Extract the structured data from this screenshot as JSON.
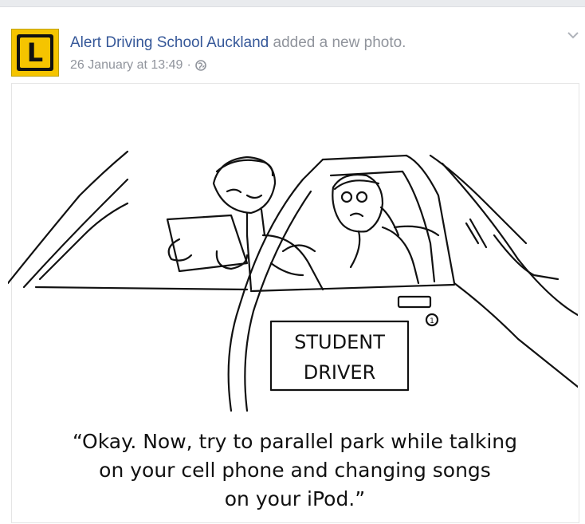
{
  "post": {
    "page_name": "Alert Driving School Auckland",
    "action": "added a new photo.",
    "timestamp": "26 January at 13:49",
    "separator": "·",
    "avatar_letter": "L"
  },
  "photo": {
    "sign_line_1": "STUDENT",
    "sign_line_2": "DRIVER",
    "sign_circle": "1",
    "caption_lines": [
      "“Okay. Now, try to parallel park while talking",
      "on your cell phone and changing songs",
      "on your iPod.”"
    ]
  },
  "icons": {
    "globe": "globe-icon",
    "chevron": "chevron-down-icon",
    "avatar": "learner-plate-logo"
  },
  "colors": {
    "link": "#365899",
    "muted": "#90949c",
    "plate_yellow": "#f5c400"
  }
}
